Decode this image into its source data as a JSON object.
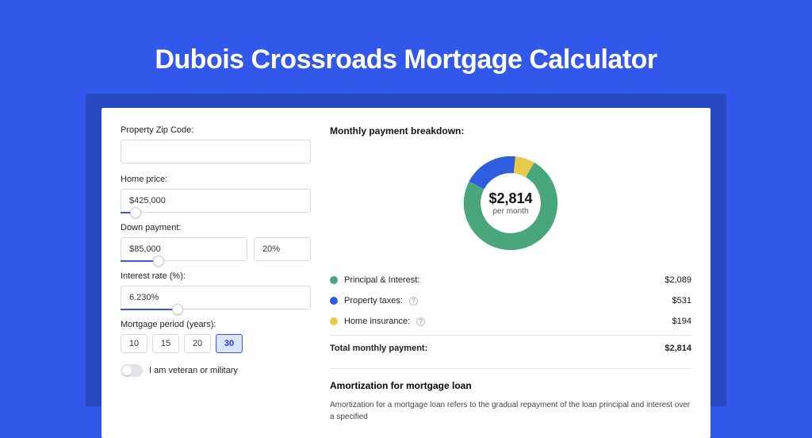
{
  "page": {
    "title": "Dubois Crossroads Mortgage Calculator"
  },
  "form": {
    "zip": {
      "label": "Property Zip Code:",
      "value": ""
    },
    "home_price": {
      "label": "Home price:",
      "value": "$425,000",
      "slider_pct": 8
    },
    "down_payment": {
      "label": "Down payment:",
      "value": "$85,000",
      "pct": "20%",
      "slider_pct": 20
    },
    "interest_rate": {
      "label": "Interest rate (%):",
      "value": "6.230%",
      "slider_pct": 30
    },
    "period": {
      "label": "Mortgage period (years):",
      "options": [
        "10",
        "15",
        "20",
        "30"
      ],
      "selected": "30"
    },
    "veteran": {
      "label": "I am veteran or military",
      "checked": false
    }
  },
  "breakdown": {
    "title": "Monthly payment breakdown:",
    "center_value": "$2,814",
    "center_label": "per month",
    "rows": [
      {
        "label": "Principal & Interest:",
        "value": "$2,089",
        "color": "green",
        "info": false
      },
      {
        "label": "Property taxes:",
        "value": "$531",
        "color": "blue",
        "info": true
      },
      {
        "label": "Home insurance:",
        "value": "$194",
        "color": "yellow",
        "info": true
      }
    ],
    "total_label": "Total monthly payment:",
    "total_value": "$2,814"
  },
  "amortization": {
    "title": "Amortization for mortgage loan",
    "body": "Amortization for a mortgage loan refers to the gradual repayment of the loan principal and interest over a specified"
  },
  "colors": {
    "accent": "#3158eb",
    "green": "#49a57b",
    "blue": "#2f5de0",
    "yellow": "#e8c94c"
  },
  "chart_data": {
    "type": "pie",
    "title": "Monthly payment breakdown",
    "center_label": "$2,814 per month",
    "series": [
      {
        "name": "Principal & Interest",
        "value": 2089,
        "color": "#49a57b"
      },
      {
        "name": "Property taxes",
        "value": 531,
        "color": "#2f5de0"
      },
      {
        "name": "Home insurance",
        "value": 194,
        "color": "#e8c94c"
      }
    ],
    "total": 2814
  }
}
